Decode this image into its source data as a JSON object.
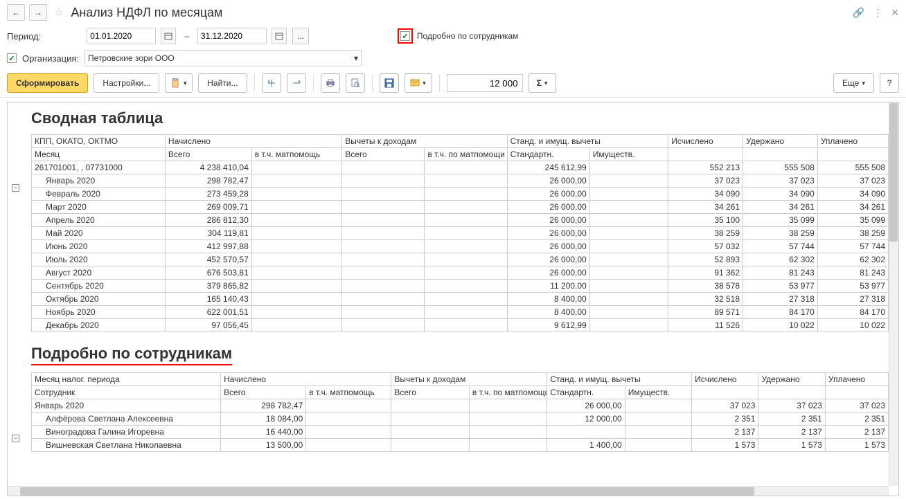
{
  "title": "Анализ НДФЛ по месяцам",
  "period_label": "Период:",
  "date_from": "01.01.2020",
  "date_to": "31.12.2020",
  "detail_checkbox_label": "Подробно по сотрудникам",
  "org_label": "Организация:",
  "org_value": "Петровские зори ООО",
  "toolbar": {
    "generate": "Сформировать",
    "settings": "Настройки...",
    "find": "Найти...",
    "more": "Еще",
    "num_value": "12 000"
  },
  "sections": {
    "summary": "Сводная таблица",
    "detail": "Подробно по сотрудникам"
  },
  "headers": {
    "kpp": "КПП, ОКАТО, ОКТМО",
    "accrued": "Начислено",
    "deductions": "Вычеты к доходам",
    "stdprop": "Станд. и имущ. вычеты",
    "calculated": "Исчислено",
    "withheld": "Удержано",
    "paid": "Уплачено",
    "month": "Месяц",
    "total": "Всего",
    "inc_aid": "в т.ч. матпомощь",
    "inc_aid2": "в т.ч. по матпомощи",
    "standard": "Стандартн.",
    "property": "Имуществ.",
    "tax_period_month": "Месяц налог. периода",
    "employee": "Сотрудник"
  },
  "summary_group": "261701001, , 07731000",
  "summary_totals": {
    "accrued": "4 238 410,04",
    "std": "245 612,99",
    "calc": "552 213",
    "with": "555 508",
    "paid": "555 508"
  },
  "months": [
    {
      "m": "Январь 2020",
      "accrued": "298 782,47",
      "std": "26 000,00",
      "calc": "37 023",
      "with": "37 023",
      "paid": "37 023"
    },
    {
      "m": "Февраль 2020",
      "accrued": "273 459,28",
      "std": "26 000,00",
      "calc": "34 090",
      "with": "34 090",
      "paid": "34 090"
    },
    {
      "m": "Март 2020",
      "accrued": "269 009,71",
      "std": "26 000,00",
      "calc": "34 261",
      "with": "34 261",
      "paid": "34 261"
    },
    {
      "m": "Апрель 2020",
      "accrued": "286 812,30",
      "std": "26 000,00",
      "calc": "35 100",
      "with": "35 099",
      "paid": "35 099"
    },
    {
      "m": "Май 2020",
      "accrued": "304 119,81",
      "std": "26 000,00",
      "calc": "38 259",
      "with": "38 259",
      "paid": "38 259"
    },
    {
      "m": "Июнь 2020",
      "accrued": "412 997,88",
      "std": "26 000,00",
      "calc": "57 032",
      "with": "57 744",
      "paid": "57 744"
    },
    {
      "m": "Июль 2020",
      "accrued": "452 570,57",
      "std": "26 000,00",
      "calc": "52 893",
      "with": "62 302",
      "paid": "62 302"
    },
    {
      "m": "Август 2020",
      "accrued": "676 503,81",
      "std": "26 000,00",
      "calc": "91 362",
      "with": "81 243",
      "paid": "81 243"
    },
    {
      "m": "Сентябрь 2020",
      "accrued": "379 865,82",
      "std": "11 200,00",
      "calc": "38 578",
      "with": "53 977",
      "paid": "53 977"
    },
    {
      "m": "Октябрь 2020",
      "accrued": "165 140,43",
      "std": "8 400,00",
      "calc": "32 518",
      "with": "27 318",
      "paid": "27 318"
    },
    {
      "m": "Ноябрь 2020",
      "accrued": "622 001,51",
      "std": "8 400,00",
      "calc": "89 571",
      "with": "84 170",
      "paid": "84 170"
    },
    {
      "m": "Декабрь 2020",
      "accrued": "97 056,45",
      "std": "9 612,99",
      "calc": "11 526",
      "with": "10 022",
      "paid": "10 022"
    }
  ],
  "detail_group": {
    "m": "Январь 2020",
    "accrued": "298 782,47",
    "std": "26 000,00",
    "calc": "37 023",
    "with": "37 023",
    "paid": "37 023"
  },
  "employees": [
    {
      "name": "Алфёрова Светлана Алексеевна",
      "accrued": "18 084,00",
      "std": "12 000,00",
      "calc": "2 351",
      "with": "2 351",
      "paid": "2 351"
    },
    {
      "name": "Виноградова Галина Игоревна",
      "accrued": "16 440,00",
      "std": "",
      "calc": "2 137",
      "with": "2 137",
      "paid": "2 137"
    },
    {
      "name": "Вишневская Светлана Николаевна",
      "accrued": "13 500,00",
      "std": "1 400,00",
      "calc": "1 573",
      "with": "1 573",
      "paid": "1 573"
    }
  ]
}
